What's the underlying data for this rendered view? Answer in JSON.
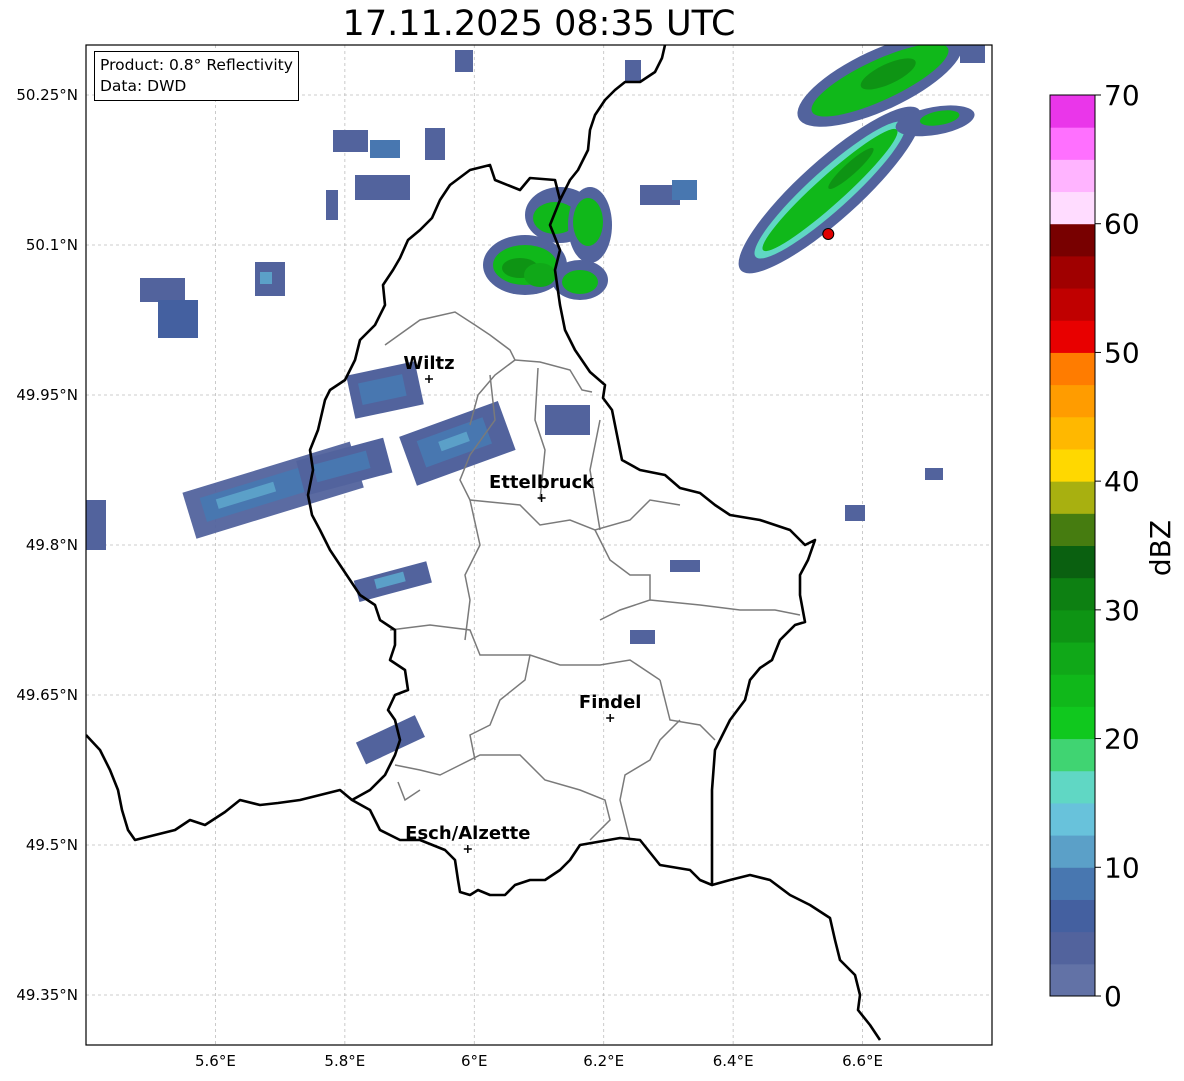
{
  "title": "17.11.2025 08:35 UTC",
  "info": {
    "product": "Product: 0.8° Reflectivity",
    "source": "Data: DWD"
  },
  "cities": [
    {
      "name": "Wiltz",
      "lon": 5.93,
      "lat": 49.966
    },
    {
      "name": "Ettelbruck",
      "lon": 6.104,
      "lat": 49.847
    },
    {
      "name": "Findel",
      "lon": 6.21,
      "lat": 49.627
    },
    {
      "name": "Esch/Alzette",
      "lon": 5.99,
      "lat": 49.496
    }
  ],
  "marker": {
    "lon": 6.547,
    "lat": 50.111,
    "color": "#e00000"
  },
  "lon_ticks": [
    "5.6°E",
    "5.8°E",
    "6°E",
    "6.2°E",
    "6.4°E",
    "6.6°E"
  ],
  "lat_ticks": [
    "50.25°N",
    "50.1°N",
    "49.95°N",
    "49.8°N",
    "49.65°N",
    "49.5°N",
    "49.35°N"
  ],
  "colorbar": {
    "label": "dBZ",
    "ticks": [
      "0",
      "10",
      "20",
      "30",
      "40",
      "50",
      "60",
      "70"
    ],
    "colors": [
      "#6272a6",
      "#52639d",
      "#4460a0",
      "#4877b0",
      "#5ba0c8",
      "#68c2db",
      "#60d7c4",
      "#40d472",
      "#10c81e",
      "#10b81a",
      "#10a818",
      "#0e9414",
      "#0d8012",
      "#0a6010",
      "#467c10",
      "#a8b010",
      "#ffd800",
      "#ffb800",
      "#ff9c00",
      "#ff7c00",
      "#e80000",
      "#c00000",
      "#a00000",
      "#780000",
      "#ffdcff",
      "#ffb4ff",
      "#ff70ff",
      "#ea36ea"
    ]
  }
}
